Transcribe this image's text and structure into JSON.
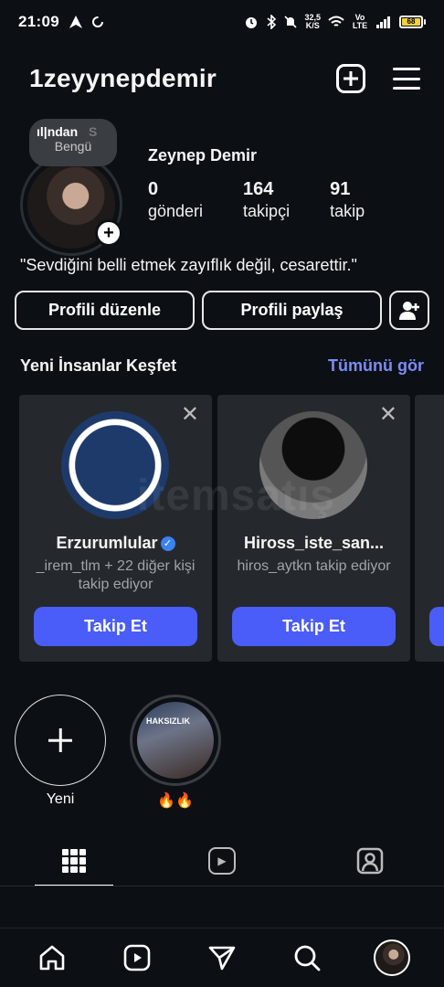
{
  "status_bar": {
    "time": "21:09",
    "speed_value": "32,5",
    "speed_unit": "K/S",
    "network": "Vo LTE",
    "battery": "68"
  },
  "header": {
    "username": "1zeyynepdemir",
    "create_icon": "plus-square-icon",
    "menu_icon": "hamburger-menu-icon"
  },
  "profile": {
    "note_song": "ıl|ndan",
    "note_song_extra": "S",
    "note_artist": "Bengü",
    "full_name": "Zeynep Demir",
    "stats": [
      {
        "value": "0",
        "label": "gönderi"
      },
      {
        "value": "164",
        "label": "takipçi"
      },
      {
        "value": "91",
        "label": "takip"
      }
    ],
    "bio": "\"Sevdiğini belli etmek zayıflık değil, cesarettir.\"",
    "edit_button": "Profili düzenle",
    "share_button": "Profili paylaş"
  },
  "discover": {
    "title": "Yeni İnsanlar Keşfet",
    "see_all": "Tümünü gör",
    "cards": [
      {
        "name": "Erzurumlular",
        "verified": true,
        "subtitle": "_irem_tlm + 22 diğer kişi takip ediyor",
        "button": "Takip Et"
      },
      {
        "name": "Hiross_iste_san...",
        "verified": false,
        "subtitle": "hiros_aytkn takip ediyor",
        "button": "Takip Et"
      }
    ]
  },
  "highlights": [
    {
      "label": "Yeni"
    },
    {
      "label": "🔥🔥",
      "cover_text": "HAKSIZLIK"
    }
  ],
  "watermark": "itemsatış",
  "colors": {
    "background": "#0c1014",
    "accent_link": "#7b8cf5",
    "follow_button": "#4a5df9",
    "card_bg": "#25292e"
  }
}
